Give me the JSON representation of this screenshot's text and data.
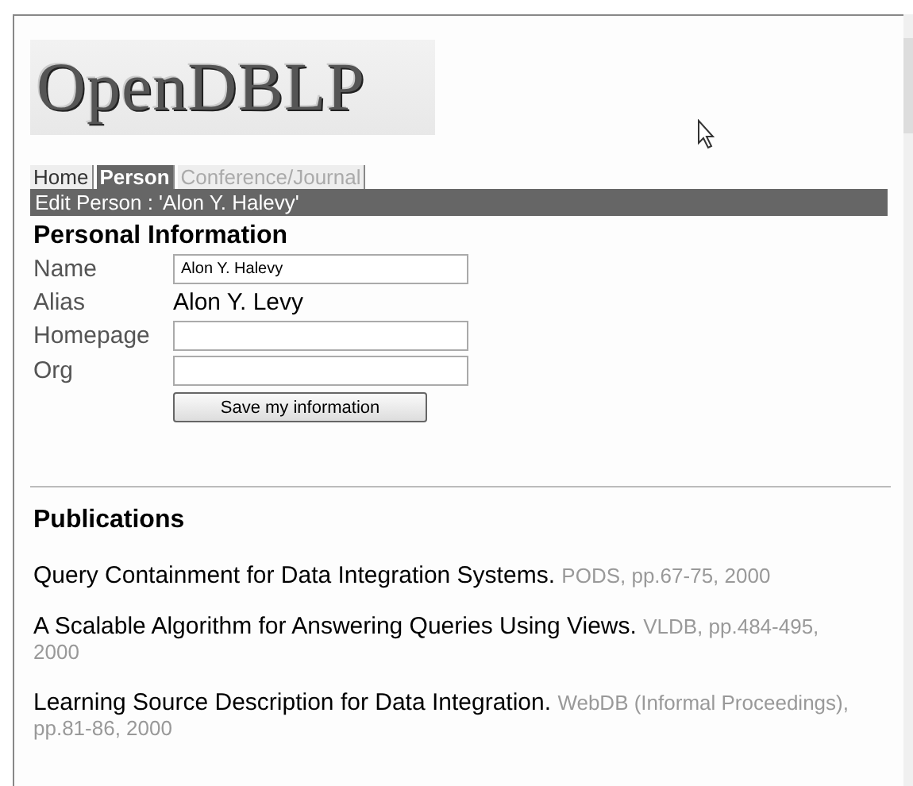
{
  "logo": {
    "text": "OpenDBLP"
  },
  "tabs": [
    {
      "label": "Home",
      "selected": false,
      "disabled": false
    },
    {
      "label": "Person",
      "selected": true,
      "disabled": false
    },
    {
      "label": "Conference/Journal",
      "selected": false,
      "disabled": true
    }
  ],
  "header": {
    "title": "Edit Person : 'Alon Y. Halevy'"
  },
  "personal_information": {
    "heading": "Personal Information",
    "fields": [
      {
        "kind": "input",
        "label": "Name",
        "value": "Alon Y. Halevy"
      },
      {
        "kind": "text",
        "label": "Alias",
        "value": "Alon Y. Levy"
      },
      {
        "kind": "input",
        "label": "Homepage"
      },
      {
        "kind": "input",
        "label": "Org"
      }
    ],
    "save_button": "Save my information"
  },
  "publications": {
    "heading": "Publications",
    "items": [
      {
        "title": "Query Containment for Data Integration Systems.",
        "details": "PODS, pp.67-75, 2000"
      },
      {
        "title": "A Scalable Algorithm for Answering Queries Using Views.",
        "details": "VLDB, pp.484-495, 2000"
      },
      {
        "title": "Learning Source Description for Data Integration.",
        "details": "WebDB (Informal Proceedings), pp.81-86, 2000"
      }
    ]
  }
}
